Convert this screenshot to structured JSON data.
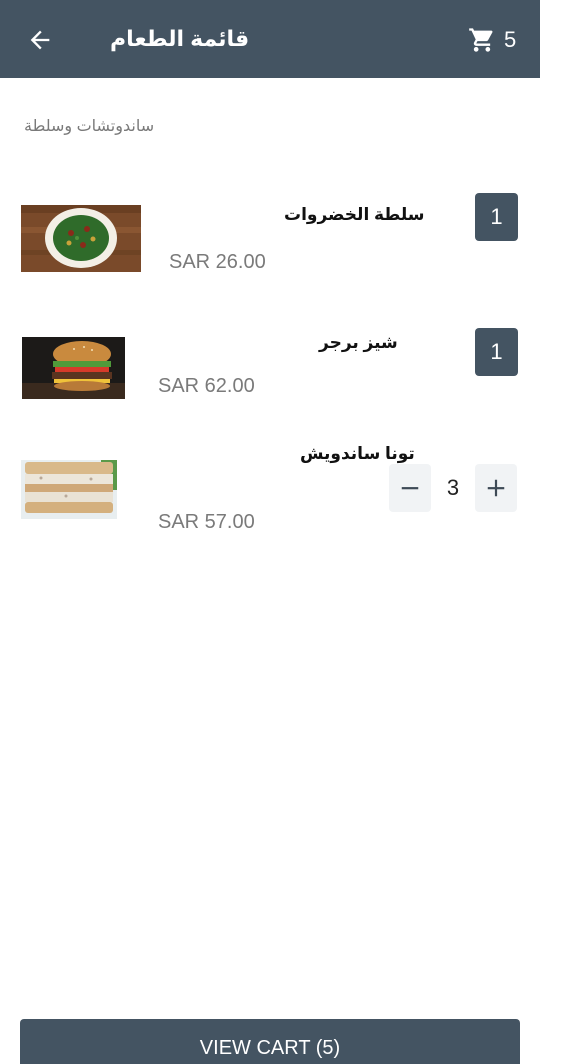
{
  "header": {
    "title": "قائمة الطعام",
    "back_icon": "arrow-left-icon",
    "cart_icon": "cart-icon",
    "cart_count": "5",
    "background_color": "#445462"
  },
  "category": {
    "label": "ساندوتشات وسلطة"
  },
  "items": [
    {
      "name": "سلطة الخضروات",
      "price": "SAR 26.00",
      "quantity": "1",
      "image": "salad-bowl-photo"
    },
    {
      "name": "شيز برجر",
      "price": "SAR 62.00",
      "quantity": "1",
      "image": "cheeseburger-photo"
    },
    {
      "name": "تونا ساندويش",
      "price": "SAR 57.00",
      "quantity": "3",
      "image": "tuna-sandwich-photo",
      "minus_icon": "minus-icon",
      "plus_icon": "plus-icon"
    }
  ],
  "footer": {
    "view_cart_label": "VIEW CART (5)"
  }
}
